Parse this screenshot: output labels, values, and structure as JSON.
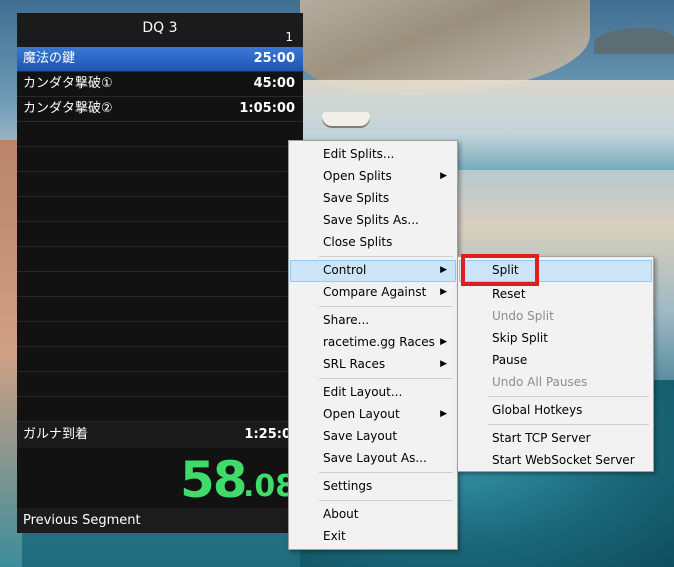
{
  "livesplit": {
    "game_title": "DQ 3",
    "attempt_count": "1",
    "splits": [
      {
        "name": "魔法の鍵",
        "time": "25:00"
      },
      {
        "name": "カンダタ撃破①",
        "time": "45:00"
      },
      {
        "name": "カンダタ撃破②",
        "time": "1:05:00"
      }
    ],
    "final_split": {
      "name": "ガルナ到着",
      "time": "1:25:0"
    },
    "timer_main": "58",
    "timer_fraction": ".08",
    "previous_segment_label": "Previous Segment"
  },
  "context_menu": {
    "edit_splits": "Edit Splits...",
    "open_splits": "Open Splits",
    "save_splits": "Save Splits",
    "save_splits_as": "Save Splits As...",
    "close_splits": "Close Splits",
    "control": "Control",
    "compare_against": "Compare Against",
    "share": "Share...",
    "racetime_races": "racetime.gg Races",
    "srl_races": "SRL Races",
    "edit_layout": "Edit Layout...",
    "open_layout": "Open Layout",
    "save_layout": "Save Layout",
    "save_layout_as": "Save Layout As...",
    "settings": "Settings",
    "about": "About",
    "exit": "Exit"
  },
  "control_submenu": {
    "split": "Split",
    "reset": "Reset",
    "undo_split": "Undo Split",
    "skip_split": "Skip Split",
    "pause": "Pause",
    "undo_all_pauses": "Undo All Pauses",
    "global_hotkeys": "Global Hotkeys",
    "start_tcp_server": "Start TCP Server",
    "start_websocket_server": "Start WebSocket Server"
  },
  "colors": {
    "timer_green": "#3fdc6a",
    "current_split_blue": "#1f55b4",
    "menu_highlight": "#cce4f7",
    "annotation_red": "#e21d1d"
  }
}
